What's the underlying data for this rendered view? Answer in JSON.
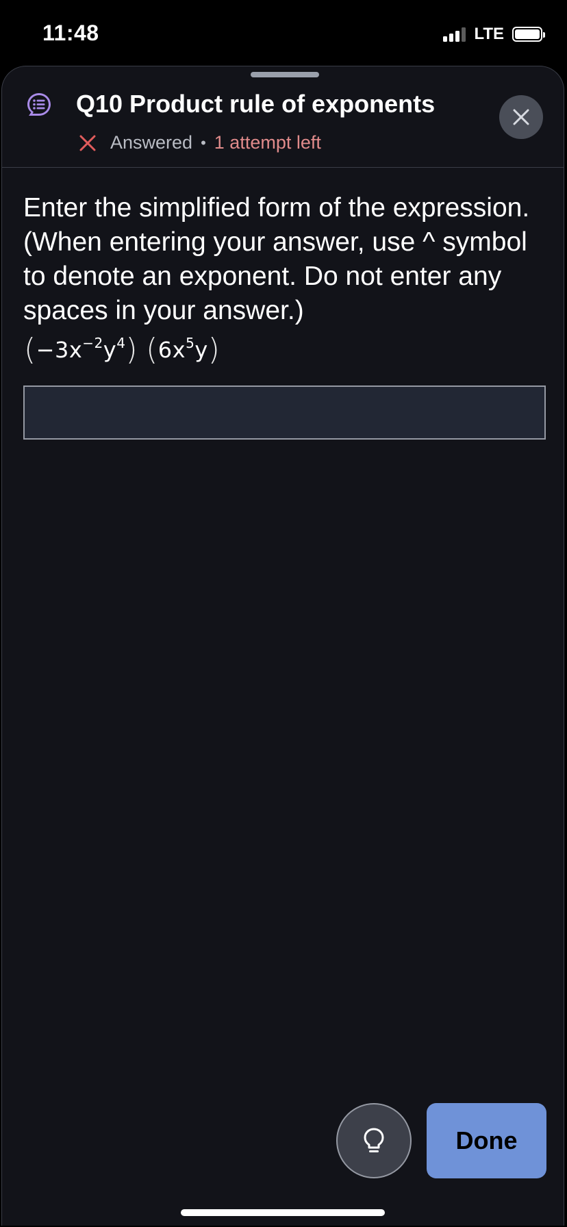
{
  "status_bar": {
    "time": "11:48",
    "network": "LTE"
  },
  "header": {
    "title": "Q10 Product rule of exponents",
    "status": "Answered",
    "separator": "•",
    "attempts": "1 attempt left"
  },
  "question": {
    "prompt": "Enter the simplified form of the expression. (When entering your answer, use ^ symbol to denote an exponent. Do not enter any spaces in your answer.)",
    "expression": {
      "open1": "(",
      "term1": "−3x",
      "exp1": "−2",
      "term2": "y",
      "exp2": "4",
      "close1": ")",
      "open2": "(",
      "term3": "6x",
      "exp3": "5",
      "term4": "y",
      "close2": ")"
    }
  },
  "answer": {
    "value": ""
  },
  "footer": {
    "done_label": "Done"
  },
  "icons": {
    "question": "question-list-icon",
    "close": "close-icon",
    "incorrect": "x-mark-icon",
    "hint": "lightbulb-icon"
  },
  "colors": {
    "background": "#121319",
    "accent_purple": "#a98be8",
    "error_red": "#e08b8b",
    "done_blue": "#6f92d8",
    "input_bg": "#222734"
  }
}
